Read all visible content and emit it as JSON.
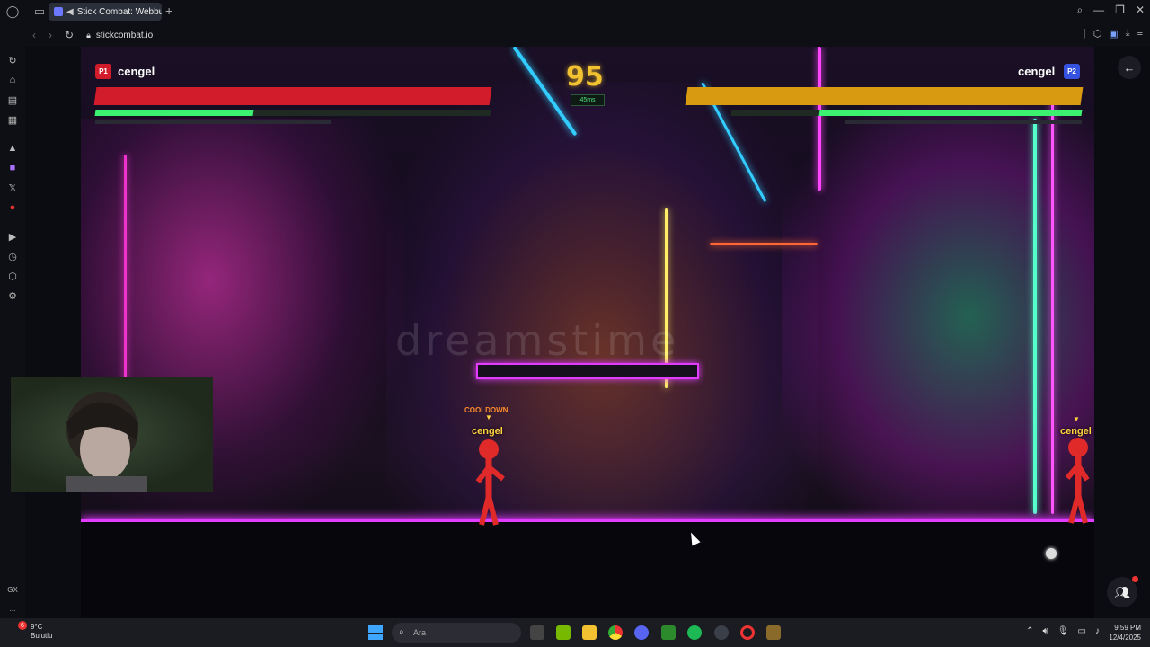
{
  "browser": {
    "tab_title": "Stick Combat: Webbu",
    "url": "stickcombat.io",
    "new_tab_symbol": "+",
    "tab_close_symbol": "✕"
  },
  "game": {
    "timer": "95",
    "ping": "45ms",
    "player1": {
      "badge": "P1",
      "name": "cengel",
      "health_fraction": 1.0,
      "health_color": "#d21c2b",
      "energy_fraction": 0.4
    },
    "player2": {
      "badge": "P2",
      "name": "cengel",
      "health_fraction": 1.0,
      "health_color": "#d89a10",
      "energy_fraction": 0.75
    },
    "fighter1": {
      "label": "cengel",
      "status": "COOLDOWN"
    },
    "fighter2": {
      "label": "cengel"
    },
    "watermark": "dreamstime",
    "accent_color": "#e13cff"
  },
  "taskbar": {
    "weather_temp": "9°C",
    "weather_desc": "Bulutlu",
    "weather_badge": "6",
    "search_placeholder": "Ara",
    "time": "9:59 PM",
    "date": "12/4/2025"
  },
  "sidebar": {
    "bottom_label": "GX",
    "more_label": "..."
  },
  "icons": {
    "opera": "opera-icon",
    "back": "back-arrow-icon",
    "friends": "friends-icon",
    "exit": "exit-arrow-icon"
  }
}
